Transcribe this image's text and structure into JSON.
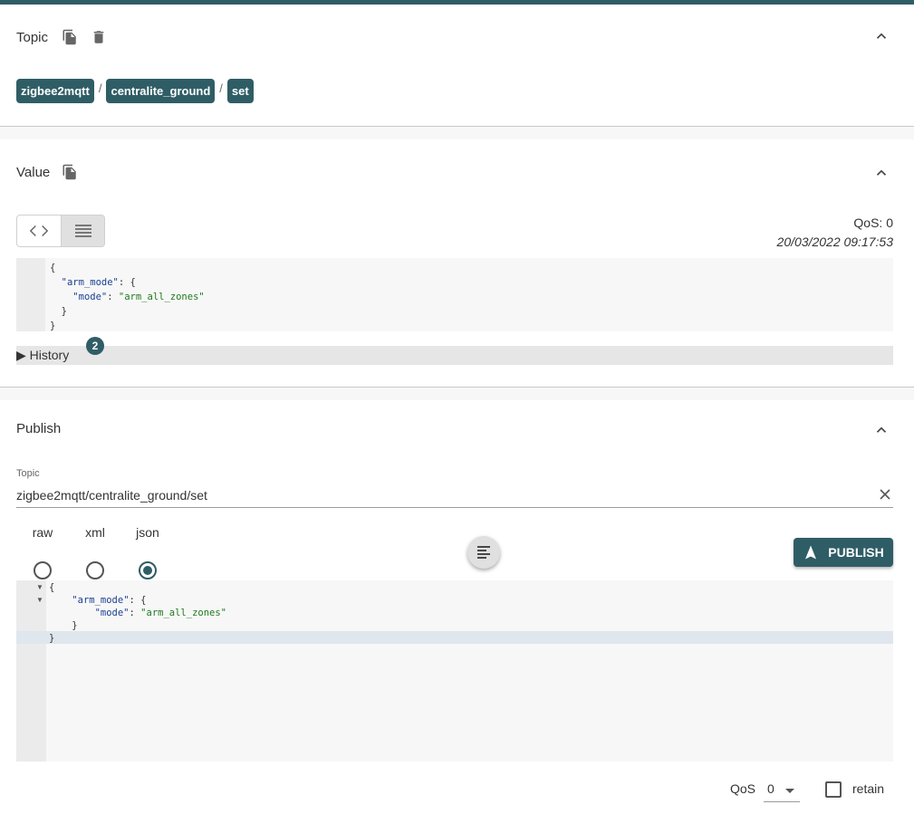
{
  "topic_panel": {
    "title": "Topic",
    "segments": [
      "zigbee2mqtt",
      "centralite_ground",
      "set"
    ],
    "separator": "/"
  },
  "value_panel": {
    "title": "Value",
    "qos_label": "QoS: 0",
    "timestamp": "20/03/2022 09:17:53",
    "json_lines": [
      [
        "{"
      ],
      [
        "  ",
        "\"arm_mode\"",
        ": {"
      ],
      [
        "    ",
        "\"mode\"",
        ": ",
        "\"arm_all_zones\""
      ],
      [
        "  }"
      ],
      [
        "}"
      ]
    ],
    "history_label": "History",
    "history_count": "2"
  },
  "publish_panel": {
    "title": "Publish",
    "topic_label": "Topic",
    "topic_value": "zigbee2mqtt/centralite_ground/set",
    "formats": [
      "raw",
      "xml",
      "json"
    ],
    "selected_format": "json",
    "publish_label": "PUBLISH",
    "qos_label": "QoS",
    "qos_value": "0",
    "retain_label": "retain",
    "retain_checked": false
  },
  "colors": {
    "accent": "#2f5d66",
    "json_key": "#1a3f8f",
    "json_string": "#1f7a1f"
  },
  "icons": [
    "copy-icon",
    "delete-icon",
    "chevron-up-icon",
    "code-icon",
    "list-icon",
    "close-icon",
    "format-icon",
    "send-icon"
  ]
}
